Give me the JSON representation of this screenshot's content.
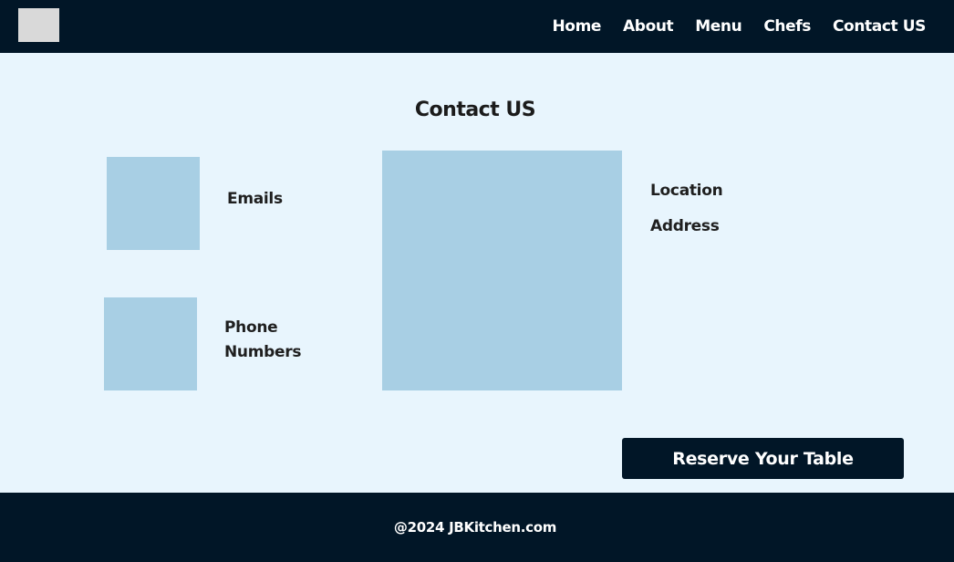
{
  "nav": {
    "items": [
      {
        "label": "Home"
      },
      {
        "label": "About"
      },
      {
        "label": "Menu"
      },
      {
        "label": "Chefs"
      },
      {
        "label": "Contact US"
      }
    ]
  },
  "contact": {
    "title": "Contact US",
    "emails_label": "Emails",
    "phone_label_line1": "Phone",
    "phone_label_line2": "Numbers",
    "location_label": "Location",
    "address_label": "Address"
  },
  "reserve": {
    "label": "Reserve Your Table"
  },
  "footer": {
    "copyright": "@2024 JBKitchen.com"
  },
  "colors": {
    "navbar_bg": "#011627",
    "page_bg": "#e8f5fd",
    "placeholder": "#a8cfe4",
    "logo_placeholder": "#d9d9d9"
  }
}
